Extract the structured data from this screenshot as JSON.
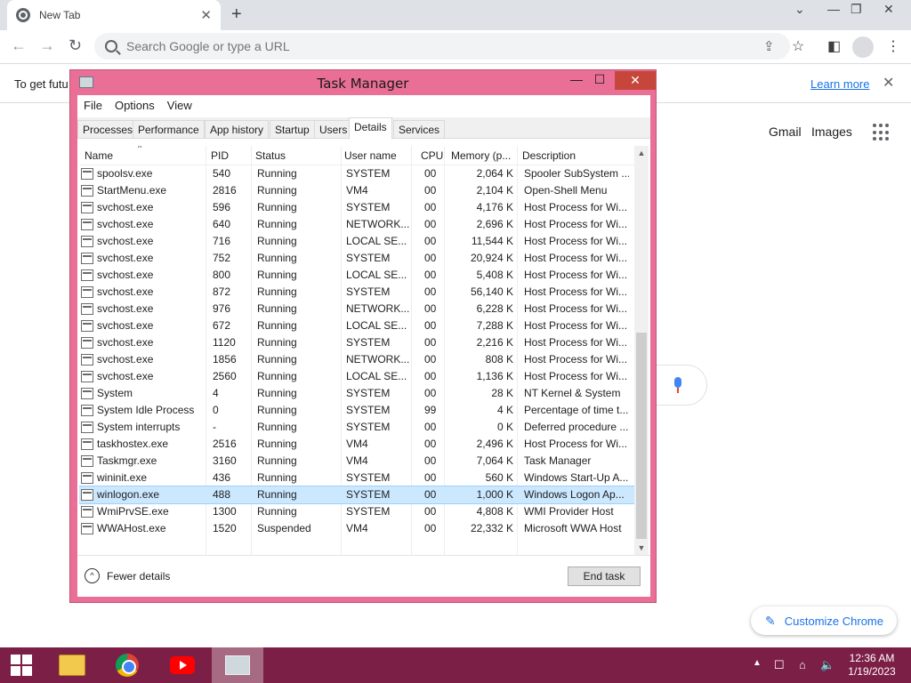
{
  "browser": {
    "tab_title": "New Tab",
    "omnibox_placeholder": "Search Google or type a URL",
    "infobar_message": "To get futu",
    "infobar_link": "Learn more",
    "links": {
      "gmail": "Gmail",
      "images": "Images"
    },
    "customize_label": "Customize Chrome"
  },
  "task_manager": {
    "title": "Task Manager",
    "menu": [
      "File",
      "Options",
      "View"
    ],
    "tabs": [
      "Processes",
      "Performance",
      "App history",
      "Startup",
      "Users",
      "Details",
      "Services"
    ],
    "active_tab": "Details",
    "columns": {
      "name": "Name",
      "pid": "PID",
      "status": "Status",
      "user": "User name",
      "cpu": "CPU",
      "memory": "Memory (p...",
      "description": "Description"
    },
    "rows": [
      {
        "name": "spoolsv.exe",
        "pid": "540",
        "status": "Running",
        "user": "SYSTEM",
        "cpu": "00",
        "memory": "2,064 K",
        "description": "Spooler SubSystem ..."
      },
      {
        "name": "StartMenu.exe",
        "pid": "2816",
        "status": "Running",
        "user": "VM4",
        "cpu": "00",
        "memory": "2,104 K",
        "description": "Open-Shell Menu"
      },
      {
        "name": "svchost.exe",
        "pid": "596",
        "status": "Running",
        "user": "SYSTEM",
        "cpu": "00",
        "memory": "4,176 K",
        "description": "Host Process for Wi..."
      },
      {
        "name": "svchost.exe",
        "pid": "640",
        "status": "Running",
        "user": "NETWORK...",
        "cpu": "00",
        "memory": "2,696 K",
        "description": "Host Process for Wi..."
      },
      {
        "name": "svchost.exe",
        "pid": "716",
        "status": "Running",
        "user": "LOCAL SE...",
        "cpu": "00",
        "memory": "11,544 K",
        "description": "Host Process for Wi..."
      },
      {
        "name": "svchost.exe",
        "pid": "752",
        "status": "Running",
        "user": "SYSTEM",
        "cpu": "00",
        "memory": "20,924 K",
        "description": "Host Process for Wi..."
      },
      {
        "name": "svchost.exe",
        "pid": "800",
        "status": "Running",
        "user": "LOCAL SE...",
        "cpu": "00",
        "memory": "5,408 K",
        "description": "Host Process for Wi..."
      },
      {
        "name": "svchost.exe",
        "pid": "872",
        "status": "Running",
        "user": "SYSTEM",
        "cpu": "00",
        "memory": "56,140 K",
        "description": "Host Process for Wi..."
      },
      {
        "name": "svchost.exe",
        "pid": "976",
        "status": "Running",
        "user": "NETWORK...",
        "cpu": "00",
        "memory": "6,228 K",
        "description": "Host Process for Wi..."
      },
      {
        "name": "svchost.exe",
        "pid": "672",
        "status": "Running",
        "user": "LOCAL SE...",
        "cpu": "00",
        "memory": "7,288 K",
        "description": "Host Process for Wi..."
      },
      {
        "name": "svchost.exe",
        "pid": "1120",
        "status": "Running",
        "user": "SYSTEM",
        "cpu": "00",
        "memory": "2,216 K",
        "description": "Host Process for Wi..."
      },
      {
        "name": "svchost.exe",
        "pid": "1856",
        "status": "Running",
        "user": "NETWORK...",
        "cpu": "00",
        "memory": "808 K",
        "description": "Host Process for Wi..."
      },
      {
        "name": "svchost.exe",
        "pid": "2560",
        "status": "Running",
        "user": "LOCAL SE...",
        "cpu": "00",
        "memory": "1,136 K",
        "description": "Host Process for Wi..."
      },
      {
        "name": "System",
        "pid": "4",
        "status": "Running",
        "user": "SYSTEM",
        "cpu": "00",
        "memory": "28 K",
        "description": "NT Kernel & System"
      },
      {
        "name": "System Idle Process",
        "pid": "0",
        "status": "Running",
        "user": "SYSTEM",
        "cpu": "99",
        "memory": "4 K",
        "description": "Percentage of time t..."
      },
      {
        "name": "System interrupts",
        "pid": "-",
        "status": "Running",
        "user": "SYSTEM",
        "cpu": "00",
        "memory": "0 K",
        "description": "Deferred procedure ..."
      },
      {
        "name": "taskhostex.exe",
        "pid": "2516",
        "status": "Running",
        "user": "VM4",
        "cpu": "00",
        "memory": "2,496 K",
        "description": "Host Process for Wi..."
      },
      {
        "name": "Taskmgr.exe",
        "pid": "3160",
        "status": "Running",
        "user": "VM4",
        "cpu": "00",
        "memory": "7,064 K",
        "description": "Task Manager"
      },
      {
        "name": "wininit.exe",
        "pid": "436",
        "status": "Running",
        "user": "SYSTEM",
        "cpu": "00",
        "memory": "560 K",
        "description": "Windows Start-Up A..."
      },
      {
        "name": "winlogon.exe",
        "pid": "488",
        "status": "Running",
        "user": "SYSTEM",
        "cpu": "00",
        "memory": "1,000 K",
        "description": "Windows Logon Ap...",
        "selected": true
      },
      {
        "name": "WmiPrvSE.exe",
        "pid": "1300",
        "status": "Running",
        "user": "SYSTEM",
        "cpu": "00",
        "memory": "4,808 K",
        "description": "WMI Provider Host"
      },
      {
        "name": "WWAHost.exe",
        "pid": "1520",
        "status": "Suspended",
        "user": "VM4",
        "cpu": "00",
        "memory": "22,332 K",
        "description": "Microsoft WWA Host"
      }
    ],
    "fewer_details": "Fewer details",
    "end_task": "End task"
  },
  "taskbar": {
    "time": "12:36 AM",
    "date": "1/19/2023"
  }
}
